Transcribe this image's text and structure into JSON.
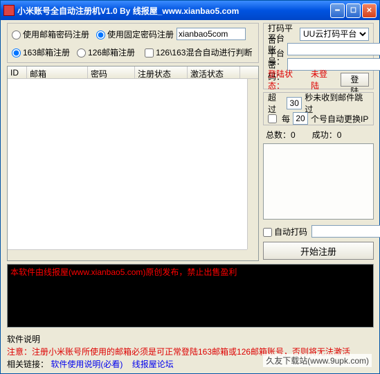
{
  "window": {
    "title": "小米账号全自动注册机V1.0 By 线报屋_www.xianbao5.com"
  },
  "reg_options": {
    "use_email_pwd": "使用邮箱密码注册",
    "use_fixed_pwd": "使用固定密码注册",
    "fixed_pwd_value": "xianbao5com",
    "mail163": "163邮箱注册",
    "mail126": "126邮箱注册",
    "mix_auto": "126\\163混合自动进行判断"
  },
  "platform": {
    "label_platform": "打码平台：",
    "platform_value": "UU云打码平台",
    "label_acct": "平台账号：",
    "acct_value": "",
    "label_pwd": "平台密码：",
    "pwd_value": "",
    "login_status_label": "登陆状态：",
    "login_status_value": "未登陆",
    "login_btn": "登陆"
  },
  "timeout": {
    "prefix": "超过",
    "seconds": "30",
    "suffix": "秒未收到邮件跳过",
    "every_label_pre": "每",
    "every_count": "20",
    "every_label_post": "个号自动更换IP"
  },
  "stats": {
    "total_label": "总数：",
    "total_value": "0",
    "success_label": "成功：",
    "success_value": "0"
  },
  "autodama": {
    "label": "自动打码",
    "value": ""
  },
  "start_btn": "开始注册",
  "table": {
    "headers": [
      "ID",
      "邮箱",
      "密码",
      "注册状态",
      "激活状态"
    ]
  },
  "notice": {
    "line1": "本软件由线报屋(www.xianbao5.com)原创发布，禁止出售盈利"
  },
  "footer": {
    "desc_label": "软件说明",
    "warning": "注意：注册小米账号所使用的邮箱必须是可正常登陆163邮箱或126邮箱账号，否则将无法激活",
    "links_label": "相关链接：",
    "link1": "软件使用说明(必看)",
    "link2": "线报屋论坛"
  },
  "watermark": "久友下载站(www.9upk.com)"
}
